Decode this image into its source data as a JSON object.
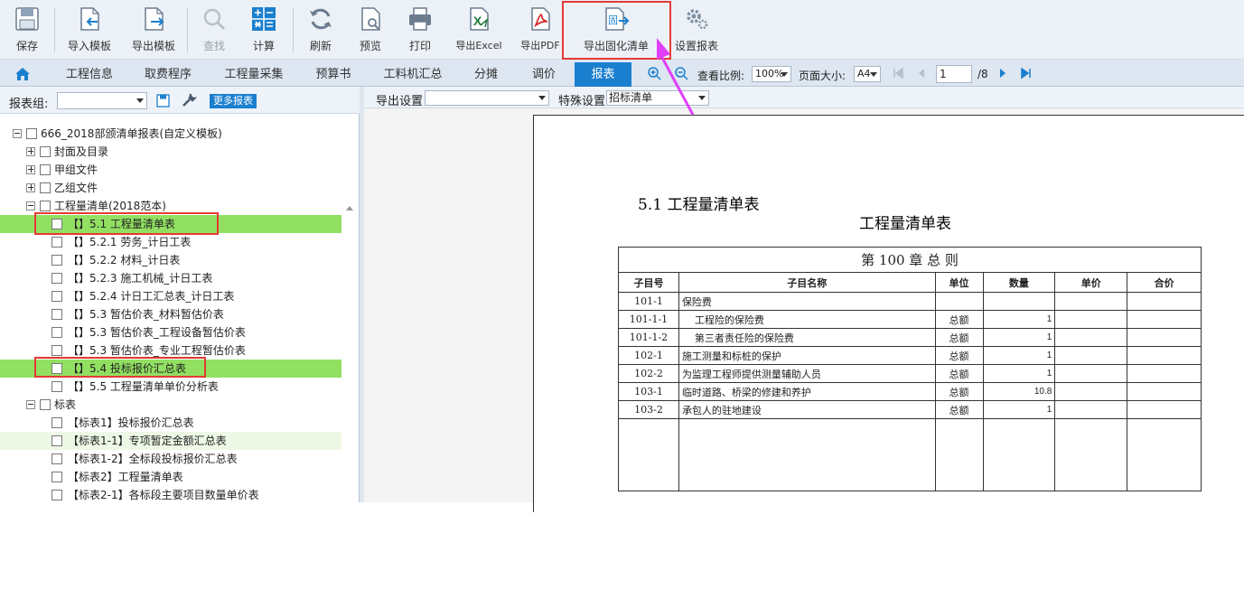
{
  "toolbar": {
    "save": "保存",
    "import_template": "导入模板",
    "export_template": "导出模板",
    "find": "查找",
    "calc": "计算",
    "refresh": "刷新",
    "preview": "预览",
    "print": "打印",
    "export_excel": "导出Excel",
    "export_pdf": "导出PDF",
    "export_fixed": "导出固化清单",
    "export_fixed_icon_text": "固",
    "report_settings": "设置报表",
    "excel_icon_text": "X"
  },
  "tabs": [
    "工程信息",
    "取费程序",
    "工程量采集",
    "预算书",
    "工料机汇总",
    "分摊",
    "调价",
    "报表"
  ],
  "viewbar": {
    "zoom_label": "查看比例:",
    "zoom_value": "100%",
    "page_size_label": "页面大小:",
    "page_size_value": "A4",
    "page_current": "1",
    "page_total": "/8"
  },
  "left": {
    "group_label": "报表组:",
    "group_value": "",
    "more_button": "更多报表",
    "tree": [
      {
        "text": "666_2018部颁清单报表(自定义模板)",
        "pm": "minus",
        "indent": 0
      },
      {
        "text": "封面及目录",
        "pm": "plus",
        "indent": 1
      },
      {
        "text": "甲组文件",
        "pm": "plus",
        "indent": 1
      },
      {
        "text": "乙组文件",
        "pm": "plus",
        "indent": 1
      },
      {
        "text": "工程量清单(2018范本)",
        "pm": "minus",
        "indent": 1
      },
      {
        "text": "【】5.1 工程量清单表",
        "pm": "",
        "indent": 2,
        "hl": "green"
      },
      {
        "text": "【】5.2.1 劳务_计日工表",
        "pm": "",
        "indent": 2
      },
      {
        "text": "【】5.2.2 材料_计日表",
        "pm": "",
        "indent": 2
      },
      {
        "text": "【】5.2.3 施工机械_计日工表",
        "pm": "",
        "indent": 2
      },
      {
        "text": "【】5.2.4 计日工汇总表_计日工表",
        "pm": "",
        "indent": 2
      },
      {
        "text": "【】5.3 暂估价表_材料暂估价表",
        "pm": "",
        "indent": 2
      },
      {
        "text": "【】5.3 暂估价表_工程设备暂估价表",
        "pm": "",
        "indent": 2
      },
      {
        "text": "【】5.3 暂估价表_专业工程暂估价表",
        "pm": "",
        "indent": 2
      },
      {
        "text": "【】5.4 投标报价汇总表",
        "pm": "",
        "indent": 2,
        "hl": "green"
      },
      {
        "text": "【】5.5 工程量清单单价分析表",
        "pm": "",
        "indent": 2
      },
      {
        "text": "标表",
        "pm": "minus",
        "indent": 1
      },
      {
        "text": "【标表1】投标报价汇总表",
        "pm": "",
        "indent": 2
      },
      {
        "text": "【标表1-1】专项暂定金额汇总表",
        "pm": "",
        "indent": 2,
        "hl": "lightgreen"
      },
      {
        "text": "【标表1-2】全标段投标报价汇总表",
        "pm": "",
        "indent": 2
      },
      {
        "text": "【标表2】工程量清单表",
        "pm": "",
        "indent": 2
      },
      {
        "text": "【标表2-1】各标段主要项目数量单价表",
        "pm": "",
        "indent": 2
      }
    ]
  },
  "right": {
    "export_settings_label": "导出设置",
    "export_settings_value": "",
    "special_settings_label": "特殊设置",
    "special_settings_value": "招标清单",
    "doc_heading": "5.1  工程量清单表",
    "doc_title": "工程量清单表",
    "chapter": "第  100  章    总          则",
    "columns": [
      "子目号",
      "子目名称",
      "单位",
      "数量",
      "单价",
      "合价"
    ],
    "rows": [
      {
        "code": "101-1",
        "name": "保险费",
        "unit": "",
        "qty": ""
      },
      {
        "code": "101-1-1",
        "name": "    工程险的保险费",
        "unit": "总额",
        "qty": "1"
      },
      {
        "code": "101-1-2",
        "name": "    第三者责任险的保险费",
        "unit": "总额",
        "qty": "1"
      },
      {
        "code": "102-1",
        "name": "施工测量和标桩的保护",
        "unit": "总额",
        "qty": "1"
      },
      {
        "code": "102-2",
        "name": "为监理工程师提供测量辅助人员",
        "unit": "总额",
        "qty": "1"
      },
      {
        "code": "103-1",
        "name": "临时道路、桥梁的修建和养护",
        "unit": "总额",
        "qty": "10.8"
      },
      {
        "code": "103-2",
        "name": "承包人的驻地建设",
        "unit": "总额",
        "qty": "1"
      }
    ]
  },
  "colors": {
    "accent": "#1b7fcf",
    "highlight": "#92e062",
    "annot": "#e53935",
    "pointer": "#e040fb"
  }
}
